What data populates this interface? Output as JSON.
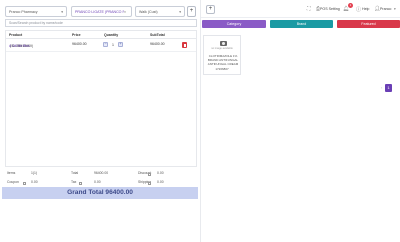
{
  "header": {
    "pharmacy_select": "Pranco Pharmacy",
    "product_pharmacy_select": "PRANCO LIGATE (PRANCO PHA",
    "customer_select": "Walk (Cust)",
    "add_customer_label": "+"
  },
  "search": {
    "placeholder": "Scan/Search product by name/code"
  },
  "cart_table": {
    "columns": [
      "Product",
      "Price",
      "Quantity",
      "SubTotal"
    ],
    "rows": [
      {
        "name": "4 Oil Me Bot..",
        "batch": "(SL:35512009)",
        "price": "96400.00",
        "quantity": "1",
        "subtotal": "96400.00"
      }
    ]
  },
  "totals": {
    "items_label": "Items",
    "items_value": "1(1)",
    "total_label": "Total",
    "total_value": "96400.00",
    "discount_label": "Discount",
    "discount_value": "0.00",
    "coupon_label": "Coupon",
    "coupon_value": "0.00",
    "tax_label": "Tax",
    "tax_value": "0.00",
    "shipping_label": "Shipping",
    "shipping_value": "0.00"
  },
  "grand_total": "Grand Total 96400.00",
  "topbar": {
    "add_label": "+",
    "pos_setting_label": "POS Setting",
    "notification_count": "1",
    "help_label": "Help",
    "user_label": "Pranco"
  },
  "tabs": {
    "category": "Category",
    "brand": "Brand",
    "featured": "Featured"
  },
  "products": [
    {
      "no_image": "no image available",
      "name": "CLOTRIMAZOLE 1% BRAND ANTIFUNGAL ANTIFUNGAL CREAM",
      "code": "17266807"
    }
  ],
  "pagination": {
    "prev": "‹",
    "current": "1"
  },
  "colors": {
    "category_tab": "#8a5bc6",
    "brand_tab": "#1a9aa3",
    "featured_tab": "#d9384a",
    "grand_total_bg": "#c7d0f0",
    "accent": "#6a3fb5"
  }
}
